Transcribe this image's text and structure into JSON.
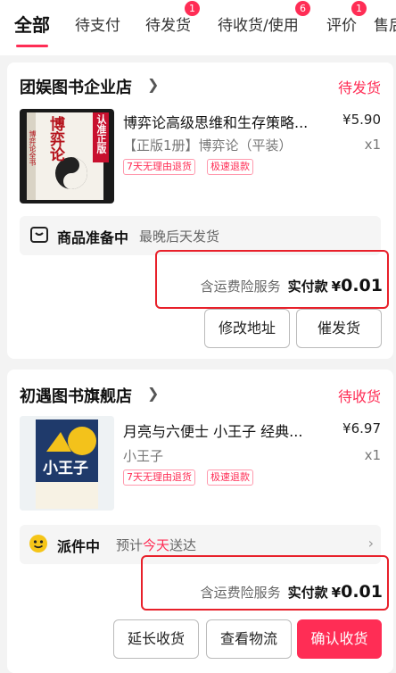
{
  "tabs": [
    {
      "label": "全部"
    },
    {
      "label": "待支付"
    },
    {
      "label": "待发货",
      "badge": "1"
    },
    {
      "label": "待收货/使用",
      "badge": "6"
    },
    {
      "label": "评价",
      "badge": "1"
    },
    {
      "label": "售后"
    }
  ],
  "orders": [
    {
      "shop": "团娱图书企业店",
      "status": "待发货",
      "product": {
        "title": "博弈论高级思维和生存策略...",
        "price": "¥5.90",
        "spec": "【正版1册】博弈论（平装）",
        "qty": "x1",
        "tags": [
          "7天无理由退货",
          "极速退款"
        ],
        "cover_text": "博弈论",
        "cover_side": "博弈论全书",
        "cover_ribbon": "认准正版"
      },
      "shipping": {
        "title": "商品准备中",
        "desc": "最晚后天发货"
      },
      "total": {
        "service": "含运费险服务",
        "pay_label": "实付款",
        "currency": "¥",
        "amount": "0.01"
      },
      "buttons": [
        "修改地址",
        "催发货"
      ]
    },
    {
      "shop": "初遇图书旗舰店",
      "status": "待收货",
      "product": {
        "title": "月亮与六便士 小王子 经典...",
        "price": "¥6.97",
        "spec": "小王子",
        "qty": "x1",
        "tags": [
          "7天无理由退货",
          "极速退款"
        ],
        "cover_text": "小王子"
      },
      "shipping": {
        "title": "派件中",
        "desc_prefix": "预计",
        "desc_hl": "今天",
        "desc_suffix": "送达"
      },
      "total": {
        "service": "含运费险服务",
        "pay_label": "实付款",
        "currency": "¥",
        "amount": "0.01"
      },
      "buttons": [
        "延长收货",
        "查看物流",
        "确认收货"
      ]
    }
  ],
  "colors": {
    "accent": "#ff2d55",
    "highlight_box": "#e8202a",
    "bg": "#f3f3f3"
  }
}
